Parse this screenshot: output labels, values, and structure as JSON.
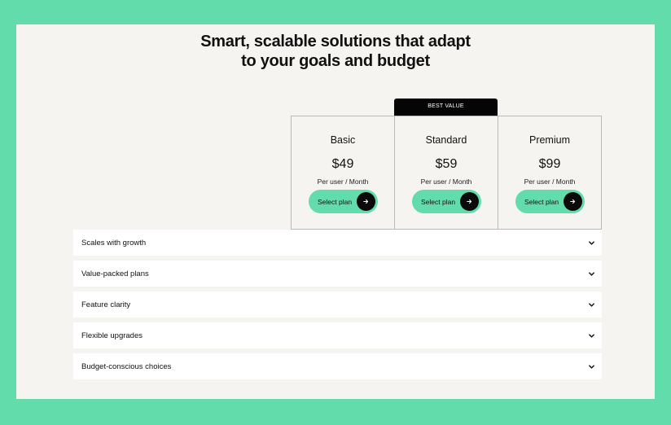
{
  "headline": {
    "line1": "Smart, scalable solutions that adapt",
    "line2": "to your goals and budget"
  },
  "badge": "BEST VALUE",
  "plans": [
    {
      "name": "Basic",
      "price": "$49",
      "period": "Per user / Month",
      "button": "Select plan",
      "button_icon": "arrow-right-icon"
    },
    {
      "name": "Standard",
      "price": "$59",
      "period": "Per user / Month",
      "button": "Select plan",
      "button_icon": "arrow-right-icon"
    },
    {
      "name": "Premium",
      "price": "$99",
      "period": "Per user / Month",
      "button": "Select plan",
      "button_icon": "arrow-right-icon"
    }
  ],
  "features": [
    {
      "label": "Scales with growth",
      "icon": "chevron-down-icon"
    },
    {
      "label": "Value-packed plans",
      "icon": "chevron-down-icon"
    },
    {
      "label": "Feature clarity",
      "icon": "chevron-down-icon"
    },
    {
      "label": "Flexible upgrades",
      "icon": "chevron-down-icon"
    },
    {
      "label": "Budget-conscious choices",
      "icon": "chevron-down-icon"
    }
  ],
  "colors": {
    "background": "#62dcab",
    "panel": "#f5f4f1",
    "accent": "#62dcab",
    "badge": "#050505"
  }
}
